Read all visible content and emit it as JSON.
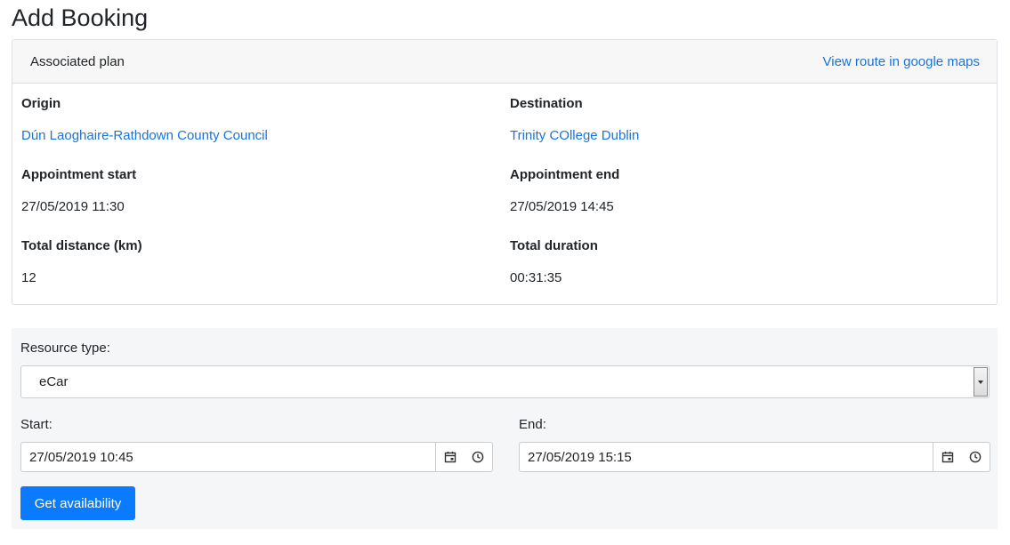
{
  "page": {
    "title": "Add Booking"
  },
  "plan": {
    "header_title": "Associated plan",
    "maps_link": "View route in google maps",
    "origin_label": "Origin",
    "origin_value": "Dún Laoghaire-Rathdown County Council",
    "destination_label": "Destination",
    "destination_value": "Trinity COllege Dublin",
    "appt_start_label": "Appointment start",
    "appt_start_value": "27/05/2019 11:30",
    "appt_end_label": "Appointment end",
    "appt_end_value": "27/05/2019 14:45",
    "distance_label": "Total distance (km)",
    "distance_value": "12",
    "duration_label": "Total duration",
    "duration_value": "00:31:35"
  },
  "form": {
    "resource_label": "Resource type:",
    "resource_value": "eCar",
    "start_label": "Start:",
    "start_value": "27/05/2019 10:45",
    "end_label": "End:",
    "end_value": "27/05/2019 15:15",
    "submit_label": "Get availability"
  },
  "colors": {
    "link": "#1a73d9",
    "primary": "#0a7bff"
  },
  "icons": {
    "date": "calendar-icon",
    "time": "clock-icon"
  }
}
